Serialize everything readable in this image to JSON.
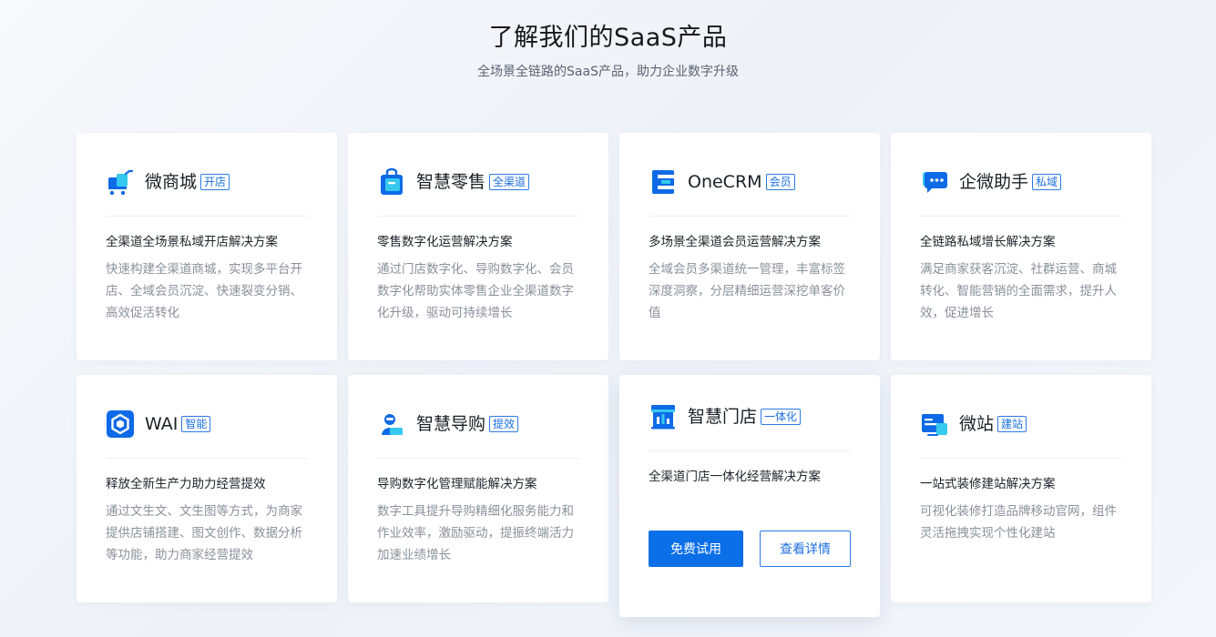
{
  "header": {
    "title": "了解我们的SaaS产品",
    "subtitle": "全场景全链路的SaaS产品，助力企业数字升级"
  },
  "colors": {
    "accent": "#0b6fe8",
    "tag_border": "#2b7be6",
    "heading": "#1f2329",
    "muted": "#8a909a"
  },
  "cards": [
    {
      "icon": "cart-icon",
      "title": "微商城",
      "tag": "开店",
      "heading": "全渠道全场景私域开店解决方案",
      "desc": "快速构建全渠道商城，实现多平台开店、全域会员沉淀、快速裂变分销、高效促活转化"
    },
    {
      "icon": "shopping-bag-icon",
      "title": "智慧零售",
      "tag": "全渠道",
      "heading": "零售数字化运营解决方案",
      "desc": "通过门店数字化、导购数字化、会员数字化帮助实体零售企业全渠道数字化升级，驱动可持续增长"
    },
    {
      "icon": "onecrm-logo-icon",
      "title": "OneCRM",
      "tag": "会员",
      "heading": "多场景全渠道会员运营解决方案",
      "desc": "全域会员多渠道统一管理，丰富标签深度洞察，分层精细运营深挖单客价值"
    },
    {
      "icon": "chat-bubble-icon",
      "title": "企微助手",
      "tag": "私域",
      "heading": "全链路私域增长解决方案",
      "desc": "满足商家获客沉淀、社群运营、商城转化、智能营销的全面需求，提升人效，促进增长"
    },
    {
      "icon": "ai-hexagon-icon",
      "title": "WAI",
      "tag": "智能",
      "heading": "释放全新生产力助力经营提效",
      "desc": "通过文生文、文生图等方式，为商家提供店铺搭建、图文创作、数据分析等功能，助力商家经营提效"
    },
    {
      "icon": "shopping-guide-icon",
      "title": "智慧导购",
      "tag": "提效",
      "heading": "导购数字化管理赋能解决方案",
      "desc": "数字工具提升导购精细化服务能力和作业效率，激励驱动，提振终端活力加速业绩增长"
    },
    {
      "icon": "storefront-icon",
      "title": "智慧门店",
      "tag": "一体化",
      "heading": "全渠道门店一体化经营解决方案",
      "desc": "",
      "primary_button": "免费试用",
      "secondary_button": "查看详情"
    },
    {
      "icon": "website-icon",
      "title": "微站",
      "tag": "建站",
      "heading": "一站式装修建站解决方案",
      "desc": "可视化装修打造品牌移动官网，组件灵活拖拽实现个性化建站"
    }
  ]
}
